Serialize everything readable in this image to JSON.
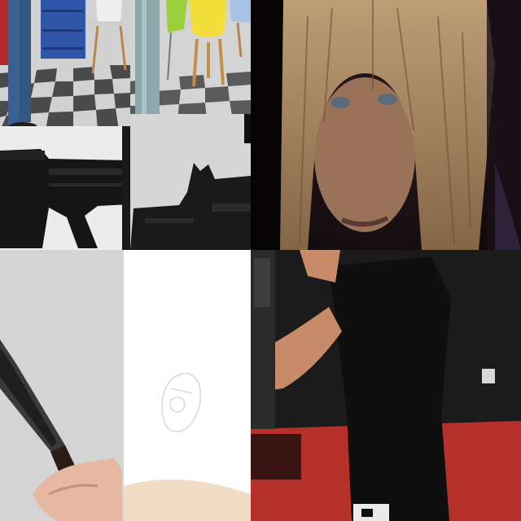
{
  "mosaic": {
    "tiles": [
      {
        "id": "tl-a",
        "subject": "person-standing-on-checkered-floor",
        "palette": [
          "#d9d9d9",
          "#4a4a4a",
          "#2f5fa6",
          "#b02a2a"
        ]
      },
      {
        "id": "tl-b",
        "subject": "colorful-chairs-in-showroom",
        "palette": [
          "#f2de3a",
          "#9bcf3b",
          "#e6e6e6",
          "#7a7a7a"
        ]
      },
      {
        "id": "tl-c",
        "subject": "rifle-silhouette-on-white",
        "palette": [
          "#ececec",
          "#151515"
        ]
      },
      {
        "id": "tl-d",
        "subject": "rifle-silhouette-on-gray",
        "palette": [
          "#d6d6d6",
          "#1a1a1a"
        ]
      },
      {
        "id": "tr",
        "subject": "blonde-woman-close-up",
        "palette": [
          "#1a1215",
          "#b7946a",
          "#8c6a4e"
        ]
      },
      {
        "id": "bl-a",
        "subject": "hand-holding-knife",
        "palette": [
          "#d4d4d4",
          "#2a2a2a",
          "#e6b8a2"
        ]
      },
      {
        "id": "bl-b",
        "subject": "blank-white-sketch",
        "palette": [
          "#ffffff",
          "#e7d1b8"
        ]
      },
      {
        "id": "br",
        "subject": "person-in-black-shirt-red-floor",
        "palette": [
          "#1e1e1e",
          "#b5312a",
          "#c98a6a"
        ]
      }
    ]
  }
}
